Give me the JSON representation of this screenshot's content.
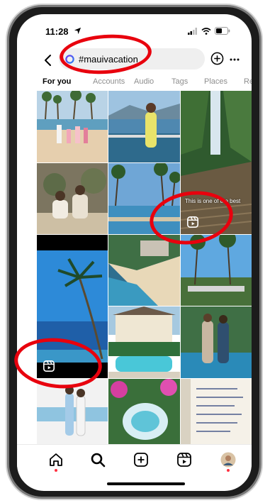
{
  "status_bar": {
    "time": "11:28"
  },
  "search": {
    "value": "#mauivacation"
  },
  "tabs": [
    {
      "label": "For you",
      "active": true
    },
    {
      "label": "Accounts",
      "active": false
    },
    {
      "label": "Audio",
      "active": false
    },
    {
      "label": "Tags",
      "active": false
    },
    {
      "label": "Places",
      "active": false
    },
    {
      "label": "Re",
      "active": false
    }
  ],
  "grid": {
    "overlay_text": "This is one of the best"
  },
  "icons": {
    "back": "back-arrow-icon",
    "hashtag": "hashtag-icon",
    "add": "add-circle-icon",
    "more": "more-icon",
    "reel": "reel-icon",
    "home": "home-icon",
    "search": "search-icon",
    "create": "create-icon",
    "reels": "reels-icon",
    "profile": "profile-avatar"
  },
  "colors": {
    "accent": "#ff3040",
    "annotation": "#e8000d",
    "tab_inactive": "#8e8e8e",
    "search_bg": "#efefef"
  }
}
